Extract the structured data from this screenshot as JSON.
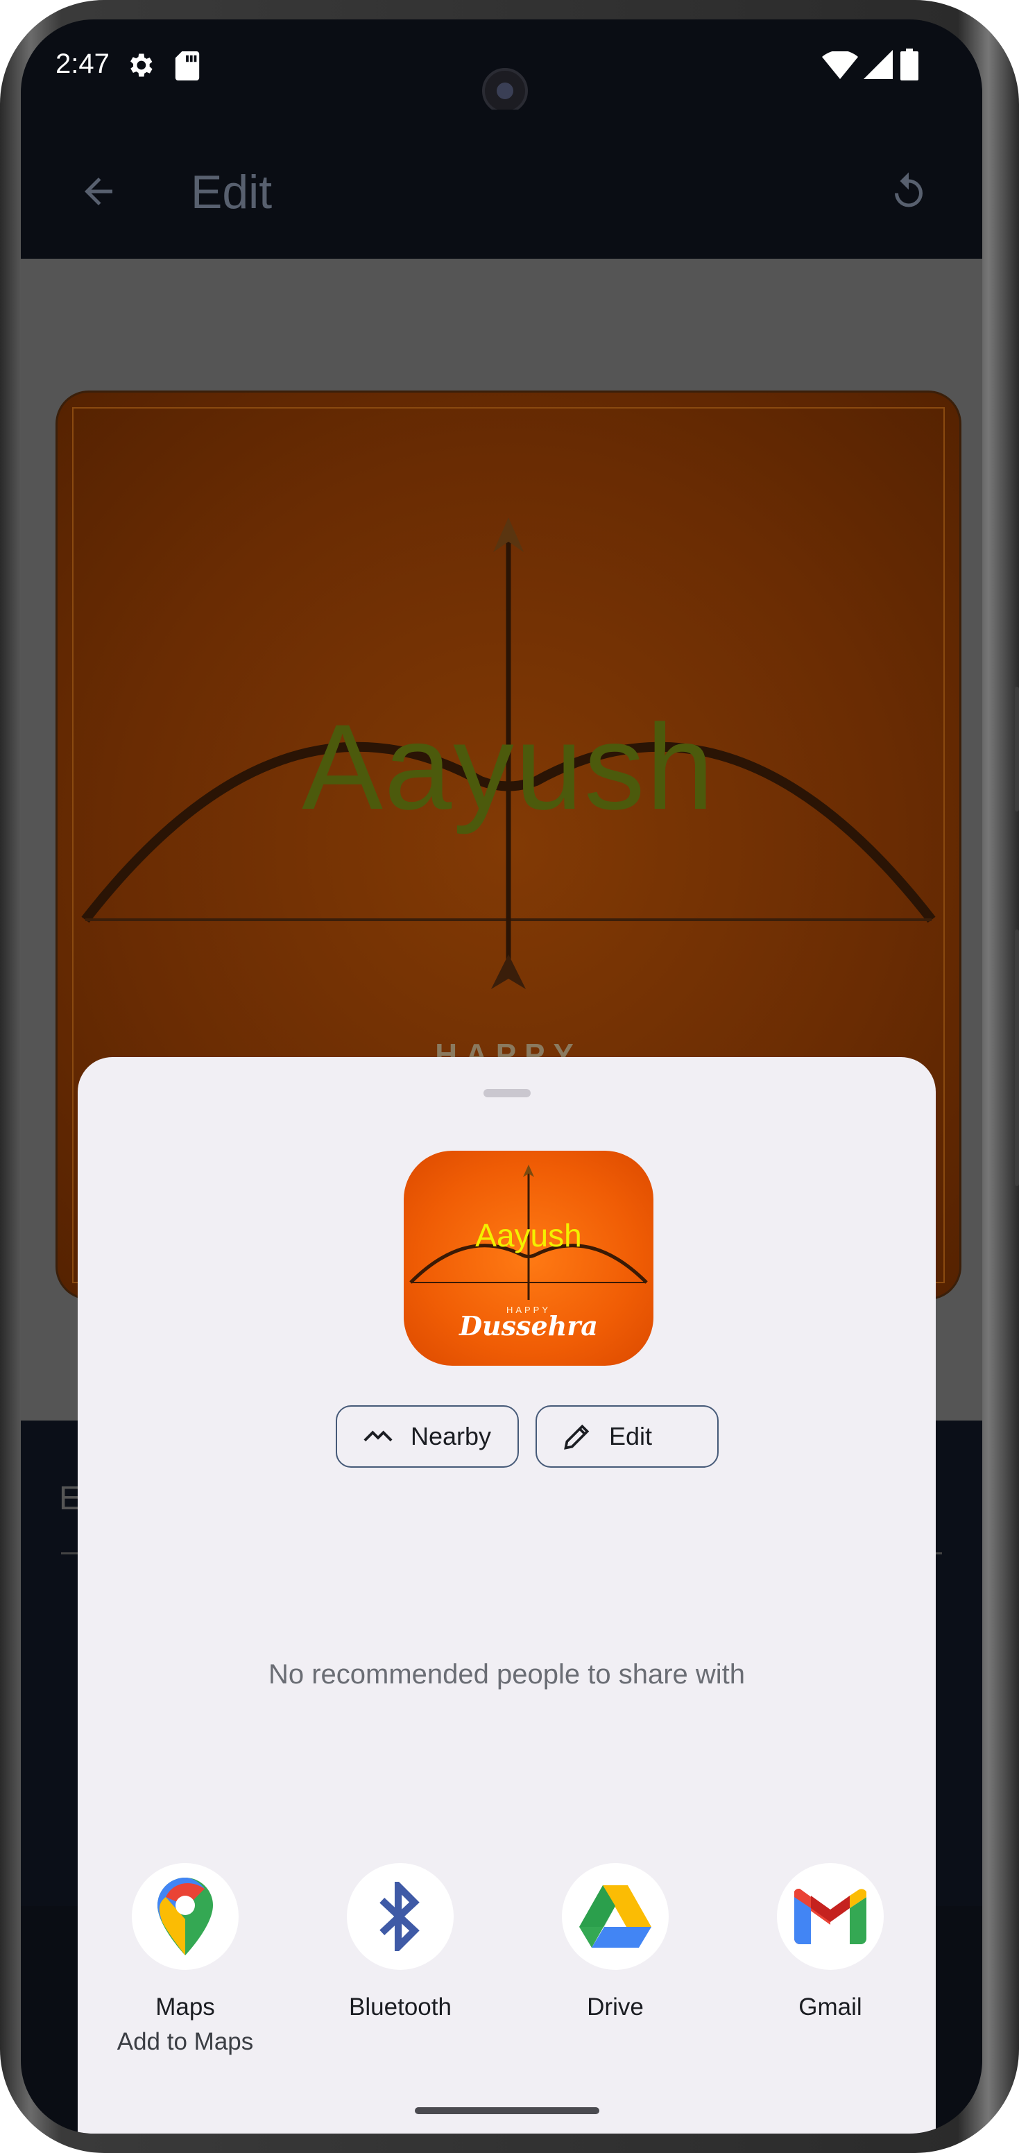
{
  "status_bar": {
    "time": "2:47"
  },
  "app_bar": {
    "title": "Edit"
  },
  "card": {
    "name_text": "Aayush",
    "happy_text": "HAPPY"
  },
  "panel": {
    "first_letter": "E"
  },
  "share_sheet": {
    "preview": {
      "name_text": "Aayush",
      "happy_text": "HAPPY",
      "title_text": "Dussehra"
    },
    "actions": [
      {
        "label": "Nearby"
      },
      {
        "label": "Edit"
      }
    ],
    "no_recommendations": "No recommended people to share with",
    "apps": [
      {
        "label": "Maps",
        "sublabel": "Add to Maps"
      },
      {
        "label": "Bluetooth",
        "sublabel": ""
      },
      {
        "label": "Drive",
        "sublabel": ""
      },
      {
        "label": "Gmail",
        "sublabel": ""
      }
    ]
  }
}
